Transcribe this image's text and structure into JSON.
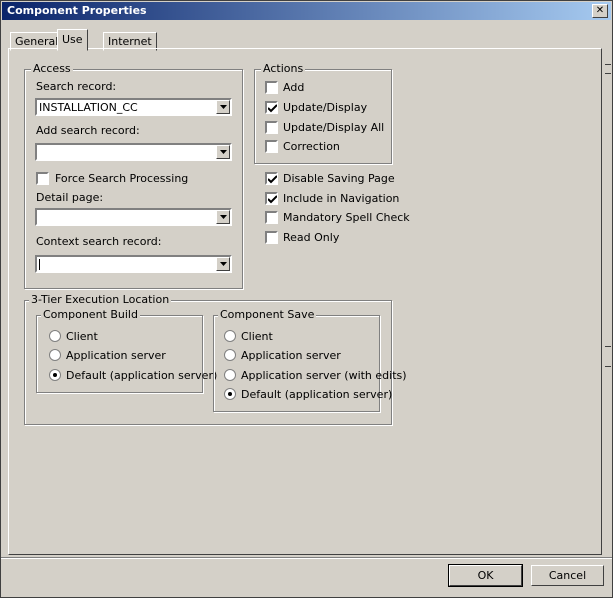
{
  "window": {
    "title": "Component Properties",
    "close_glyph": "✕"
  },
  "tabs": [
    {
      "label": "General"
    },
    {
      "label": "Use"
    },
    {
      "label": "Internet"
    }
  ],
  "access": {
    "legend": "Access",
    "search_record_label": "Search record:",
    "search_record_value": "INSTALLATION_CC",
    "add_search_record_label": "Add search record:",
    "add_search_record_value": "",
    "force_search_label": "Force Search Processing",
    "force_search_checked": false,
    "detail_page_label": "Detail page:",
    "detail_page_value": "",
    "context_search_label": "Context search record:",
    "context_search_value": ""
  },
  "actions": {
    "legend": "Actions",
    "items": [
      {
        "label": "Add",
        "checked": false
      },
      {
        "label": "Update/Display",
        "checked": true
      },
      {
        "label": "Update/Display All",
        "checked": false
      },
      {
        "label": "Correction",
        "checked": false
      }
    ]
  },
  "options": [
    {
      "label": "Disable Saving Page",
      "checked": true
    },
    {
      "label": "Include in Navigation",
      "checked": true
    },
    {
      "label": "Mandatory Spell Check",
      "checked": false
    },
    {
      "label": "Read Only",
      "checked": false
    }
  ],
  "execution": {
    "legend": "3-Tier Execution Location",
    "build": {
      "legend": "Component Build",
      "options": [
        {
          "label": "Client",
          "selected": false
        },
        {
          "label": "Application server",
          "selected": false
        },
        {
          "label": "Default (application server)",
          "selected": true
        }
      ]
    },
    "save": {
      "legend": "Component Save",
      "options": [
        {
          "label": "Client",
          "selected": false
        },
        {
          "label": "Application server",
          "selected": false
        },
        {
          "label": "Application server (with edits)",
          "selected": false
        },
        {
          "label": "Default (application server)",
          "selected": true
        }
      ]
    }
  },
  "buttons": {
    "ok": "OK",
    "cancel": "Cancel"
  }
}
